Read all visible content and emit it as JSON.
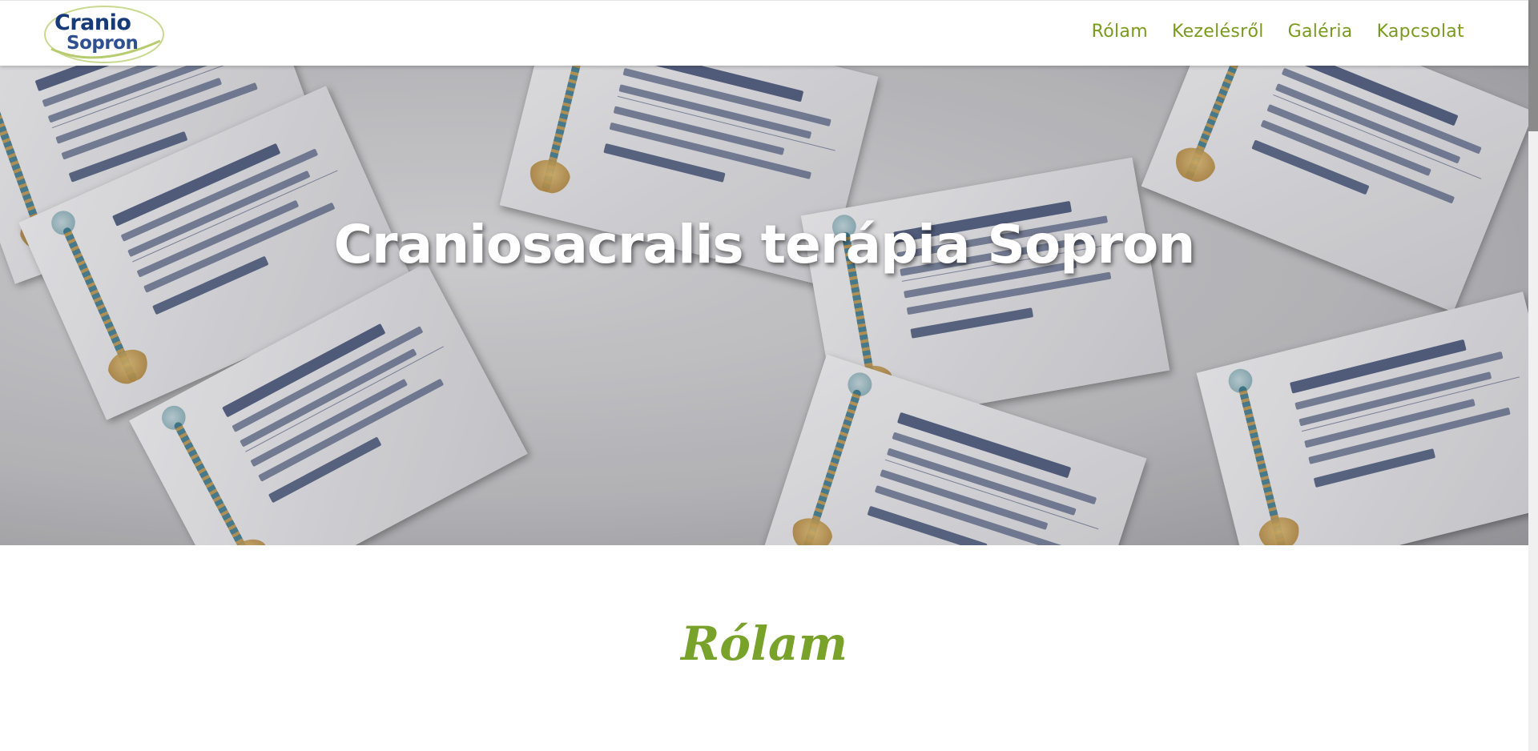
{
  "header": {
    "logo": {
      "letters_cranio": "Cranio",
      "letters_sopron": "Sopron",
      "text_color": "#173a78",
      "accent_color": "#6e9a1f"
    },
    "nav": [
      {
        "label": "Rólam"
      },
      {
        "label": "Kezelésről"
      },
      {
        "label": "Galéria"
      },
      {
        "label": "Kapcsolat"
      }
    ],
    "nav_color": "#7a9a1e"
  },
  "hero": {
    "title": "Craniosacralis terápia Sopron",
    "image": "business-cards-photo"
  },
  "section": {
    "title": "Rólam",
    "title_color": "#78a22a"
  },
  "scrollbar": {
    "position_fraction": 0.0
  }
}
